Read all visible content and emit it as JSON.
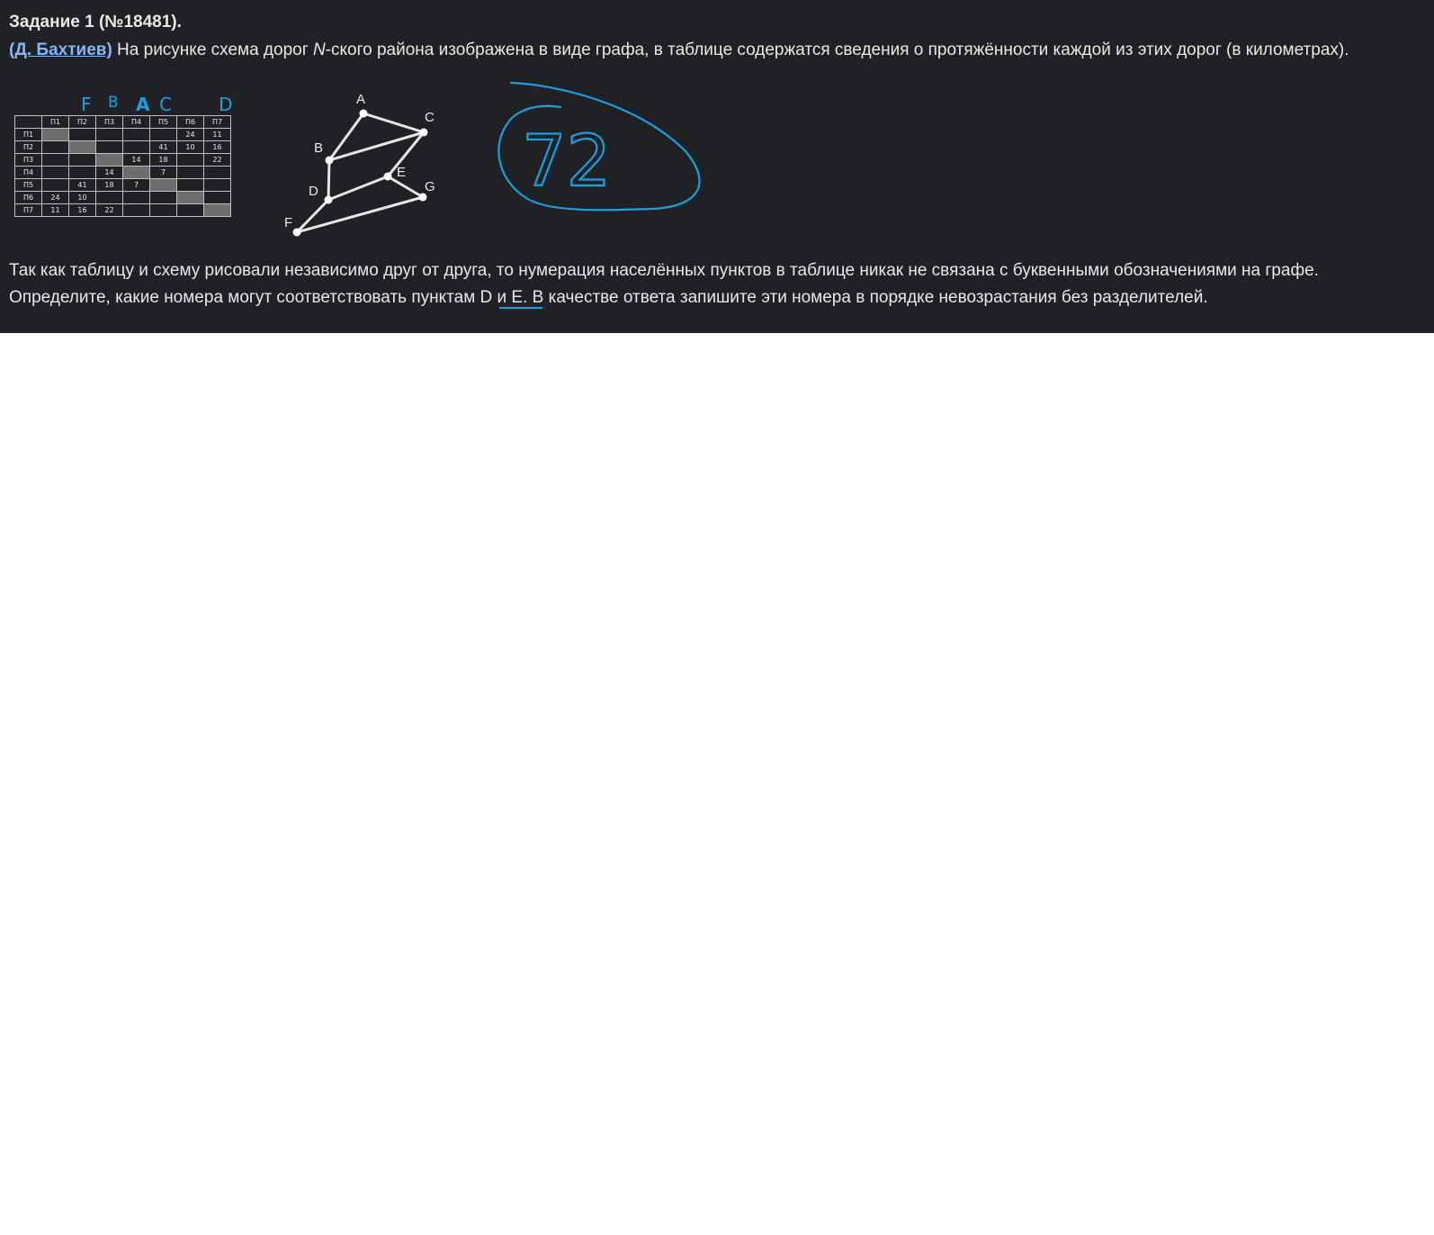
{
  "task": {
    "title": "Задание 1 (№18481).",
    "author_link": "(Д. Бахтиев)",
    "intro_before_italic": " На рисунке схема дорог ",
    "italic_letter": "N",
    "intro_after_italic": "-ского района изображена в виде графа, в таблице содержатся сведения о протяжённости каждой из этих дорог (в километрах).",
    "question_line_1": "Так как таблицу и схему рисовали независимо друг от друга, то нумерация населённых пунктов в таблице никак не связана с буквенными обозначениями на графе.",
    "question_line_2": "Определите, какие номера могут соответствовать пунктам D и E. В качестве ответа запишите эти номера в порядке невозрастания без разделителей."
  },
  "table": {
    "headers": [
      "П1",
      "П2",
      "П3",
      "П4",
      "П5",
      "П6",
      "П7"
    ],
    "rows": [
      {
        "label": "П1",
        "cells": [
          "",
          "",
          "",
          "",
          "",
          "24",
          "11"
        ]
      },
      {
        "label": "П2",
        "cells": [
          "",
          "",
          "",
          "",
          "41",
          "10",
          "16"
        ]
      },
      {
        "label": "П3",
        "cells": [
          "",
          "",
          "",
          "14",
          "18",
          "",
          "22"
        ]
      },
      {
        "label": "П4",
        "cells": [
          "",
          "",
          "14",
          "",
          "7",
          "",
          ""
        ]
      },
      {
        "label": "П5",
        "cells": [
          "",
          "41",
          "18",
          "7",
          "",
          "",
          ""
        ]
      },
      {
        "label": "П6",
        "cells": [
          "24",
          "10",
          "",
          "",
          "",
          "",
          ""
        ]
      },
      {
        "label": "П7",
        "cells": [
          "11",
          "16",
          "22",
          "",
          "",
          "",
          ""
        ]
      }
    ]
  },
  "handwritten": {
    "column_letters": [
      "F",
      "B",
      "A",
      "C",
      "D"
    ],
    "answer": "72",
    "ink_color": "#1a9fe0"
  },
  "graph": {
    "vertices": [
      "A",
      "B",
      "C",
      "D",
      "E",
      "F",
      "G"
    ],
    "edges": [
      [
        "A",
        "B"
      ],
      [
        "A",
        "C"
      ],
      [
        "B",
        "C"
      ],
      [
        "B",
        "D"
      ],
      [
        "C",
        "E"
      ],
      [
        "D",
        "E"
      ],
      [
        "E",
        "G"
      ],
      [
        "D",
        "F"
      ],
      [
        "F",
        "G"
      ]
    ]
  },
  "colors": {
    "panel_bg": "#202124",
    "text": "#e8e8e8",
    "link": "#8ab4f8"
  }
}
